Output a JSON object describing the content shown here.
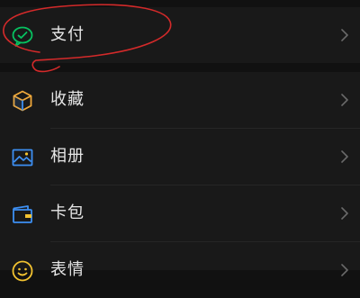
{
  "menu": {
    "group1": [
      {
        "label": "支付",
        "icon": "pay-icon",
        "color": "#07c160"
      }
    ],
    "group2": [
      {
        "label": "收藏",
        "icon": "favorites-cube-icon",
        "color": "#f0a93b"
      },
      {
        "label": "相册",
        "icon": "photo-album-icon",
        "color": "#3d8ff2"
      },
      {
        "label": "卡包",
        "icon": "card-wallet-icon",
        "color": "#3d8ff2"
      },
      {
        "label": "表情",
        "icon": "emoji-icon",
        "color": "#f2c230"
      }
    ]
  },
  "annotation": {
    "color": "#d42a2a",
    "shape": "hand-drawn circle around pay row"
  },
  "colors": {
    "background": "#111111",
    "row": "#191919",
    "text": "#e6e6e6",
    "chevron": "#6a6a6a"
  }
}
